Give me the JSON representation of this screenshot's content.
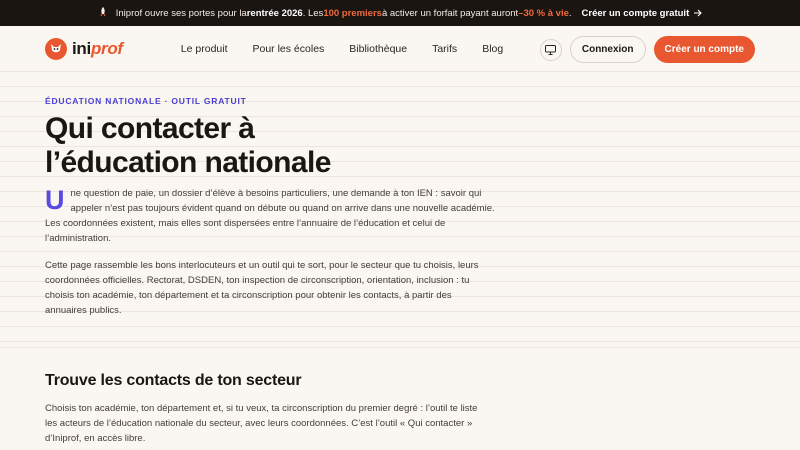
{
  "banner": {
    "t1": "Iniprof ouvre ses portes pour la ",
    "t2": "rentrée 2026",
    "t3": ". Les ",
    "t4": "100 premiers",
    "t5": " à activer un forfait payant auront ",
    "t6": "–30 % à vie",
    "t7": ".",
    "cta": "Créer un compte gratuit",
    "icon": "rocket-icon"
  },
  "nav": {
    "logo_ini": "ini",
    "logo_prof": "prof",
    "links": [
      "Le produit",
      "Pour les écoles",
      "Bibliothèque",
      "Tarifs",
      "Blog"
    ],
    "login": "Connexion",
    "signup": "Créer un compte"
  },
  "hero": {
    "eyebrow": "Éducation nationale · Outil gratuit",
    "title_line1": "Qui contacter à",
    "title_line2": "l’éducation nationale",
    "dropcap": "U",
    "p1": "ne question de paie, un dossier d’élève à besoins particuliers, une demande à ton IEN : savoir qui appeler n’est pas toujours évident quand on débute ou quand on arrive dans une nouvelle académie. Les coordonnées existent, mais elles sont dispersées entre l’annuaire de l’éducation et celui de l’administration.",
    "p2": "Cette page rassemble les bons interlocuteurs et un outil qui te sort, pour le secteur que tu choisis, leurs coordonnées officielles. Rectorat, DSDEN, ton inspection de circonscription, orientation, inclusion : tu choisis ton académie, ton département et ta circonscription pour obtenir les contacts, à partir des annuaires publics."
  },
  "section": {
    "title": "Trouve les contacts de ton secteur",
    "text": "Choisis ton académie, ton département et, si tu veux, ta circonscription du premier degré : l’outil te liste les acteurs de l’éducation nationale du secteur, avec leurs coordonnées. C’est l’outil « Qui contacter » d’Iniprof, en accès libre."
  },
  "colors": {
    "accent": "#e8572f",
    "eyebrow": "#4b3fd1",
    "dark": "#1b1512"
  }
}
